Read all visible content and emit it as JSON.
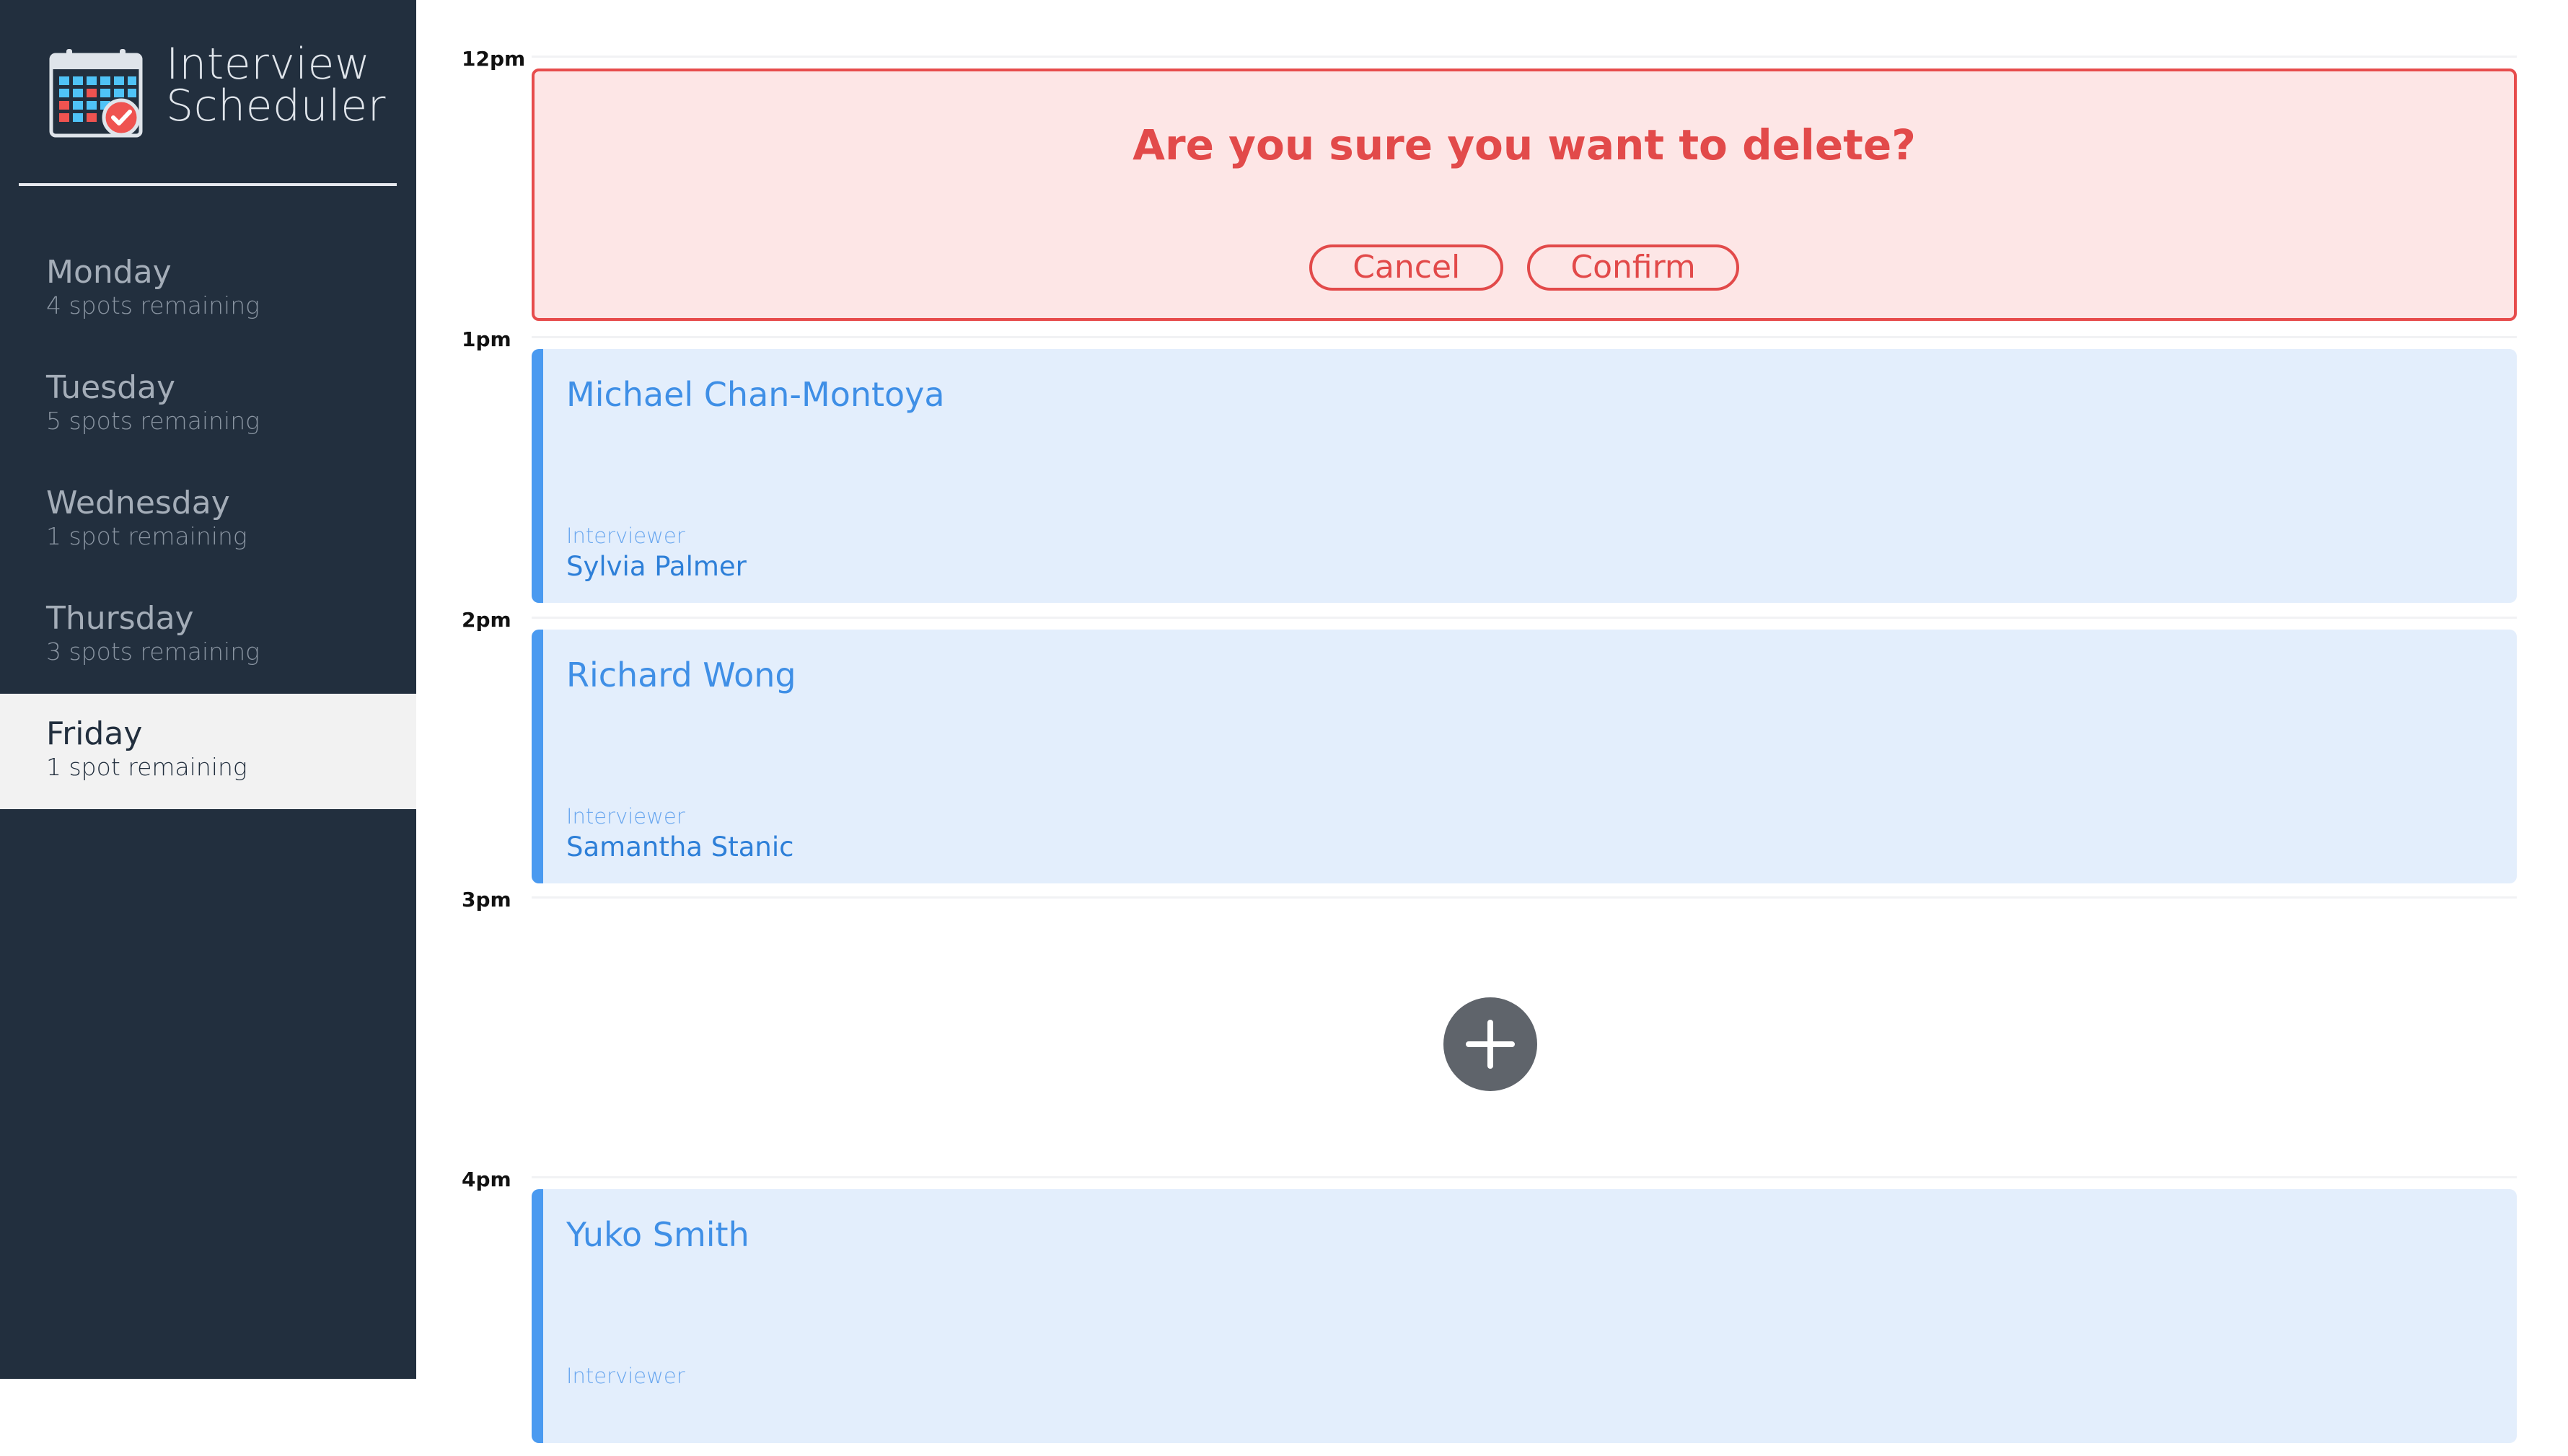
{
  "app": {
    "title_line1": "Interview",
    "title_line2": "Scheduler",
    "logo_icon": "calendar-check-icon"
  },
  "days": [
    {
      "name": "Monday",
      "spots": "4 spots remaining"
    },
    {
      "name": "Tuesday",
      "spots": "5 spots remaining"
    },
    {
      "name": "Wednesday",
      "spots": "1 spot remaining"
    },
    {
      "name": "Thursday",
      "spots": "3 spots remaining"
    },
    {
      "name": "Friday",
      "spots": "1 spot remaining"
    }
  ],
  "selected_day": "Friday",
  "schedule": {
    "times": [
      "12pm",
      "1pm",
      "2pm",
      "3pm",
      "4pm"
    ],
    "confirm": {
      "message": "Are you sure you want to delete?",
      "cancel": "Cancel",
      "confirm": "Confirm"
    },
    "appointments": [
      {
        "student": "Michael Chan-Montoya",
        "interviewer_label": "Interviewer",
        "interviewer": "Sylvia Palmer"
      },
      {
        "student": "Richard Wong",
        "interviewer_label": "Interviewer",
        "interviewer": "Samantha Stanic"
      },
      {
        "student": "Yuko Smith",
        "interviewer_label": "Interviewer",
        "interviewer": ""
      }
    ],
    "add_icon": "plus-icon"
  },
  "colors": {
    "sidebar_bg": "#222f3e",
    "danger": "#e24a4a",
    "danger_bg": "#fde6e6",
    "appointment_bg": "#e3eefc",
    "appointment_accent": "#4a9af0",
    "add_button": "#5f646b"
  }
}
